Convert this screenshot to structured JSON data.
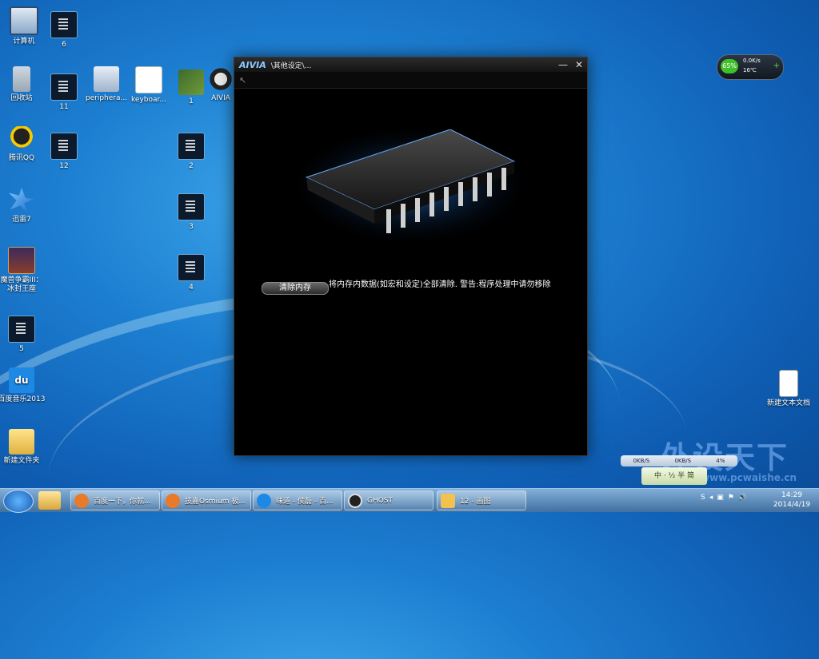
{
  "desktop_icons": [
    {
      "label": "计算机",
      "icon": "computer-icon"
    },
    {
      "label": "6",
      "icon": "video-file-icon"
    },
    {
      "label": "回收站",
      "icon": "recycle-bin-icon"
    },
    {
      "label": "11",
      "icon": "video-file-icon"
    },
    {
      "label": "periphera...",
      "icon": "peripheral-app-icon"
    },
    {
      "label": "keyboar...",
      "icon": "document-icon"
    },
    {
      "label": "1",
      "icon": "image-file-icon"
    },
    {
      "label": "AIVIA",
      "icon": "aivia-app-icon"
    },
    {
      "label": "腾讯QQ",
      "icon": "qq-icon"
    },
    {
      "label": "12",
      "icon": "video-file-icon"
    },
    {
      "label": "2",
      "icon": "video-file-icon"
    },
    {
      "label": "迅雷7",
      "icon": "thunder-icon"
    },
    {
      "label": "3",
      "icon": "video-file-icon"
    },
    {
      "label": "魔兽争霸III：冰封王座",
      "icon": "warcraft-icon"
    },
    {
      "label": "4",
      "icon": "video-file-icon"
    },
    {
      "label": "5",
      "icon": "video-file-icon"
    },
    {
      "label": "百度音乐2013",
      "icon": "baidu-music-icon"
    },
    {
      "label": "新建文件夹",
      "icon": "folder-icon"
    },
    {
      "label": "新建文本文档",
      "icon": "text-document-icon"
    }
  ],
  "window": {
    "logo": "AIVIA",
    "title": "\\其他设定\\...",
    "minimize_label": "—",
    "close_label": "✕",
    "back_label": "↖",
    "clear_button_label": "清除内存",
    "clear_description": "将内存内数据(如宏和设定)全部清除. 警告:程序处理中请勿移除"
  },
  "gadget": {
    "percent": "65%",
    "net_speed": "0.0K/s",
    "temperature": "16℃",
    "add_label": "+"
  },
  "net_bar": {
    "down": "0KB/S",
    "up": "0KB/S",
    "load": "4%"
  },
  "ime_label": "中 · ½ 半 简",
  "watermark": {
    "big": "外设天下",
    "url": "www.pcwaishe.cn"
  },
  "taskbar": {
    "items": [
      {
        "label": "百度一下，你就...",
        "icon_color": "#e87a2a"
      },
      {
        "label": "技嘉Osmium 极...",
        "icon_color": "#e87a2a"
      },
      {
        "label": "味道 - 侯磊 - 百...",
        "icon_color": "#1e88e5"
      },
      {
        "label": "GHOST",
        "icon_color": "#222222"
      },
      {
        "label": "12 - 画图",
        "icon_color": "#f2c14e"
      }
    ],
    "tray": {
      "sogou": "S",
      "volume": "🔊",
      "network": "▣",
      "flag": "⚑",
      "arrow": "◂"
    },
    "time": "14:29",
    "date": "2014/4/19"
  }
}
